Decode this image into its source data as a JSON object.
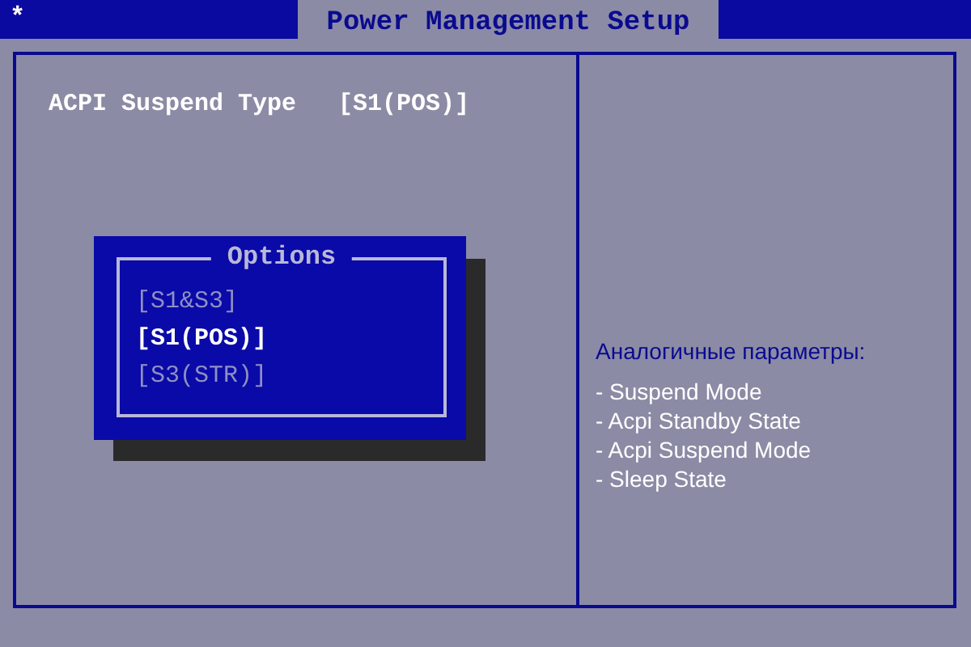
{
  "header": {
    "marker": "*",
    "title": "Power Management Setup"
  },
  "setting": {
    "label": "ACPI Suspend Type",
    "value": "[S1(POS)]"
  },
  "popup": {
    "title": "Options",
    "options": [
      {
        "label": "[S1&S3]",
        "selected": false
      },
      {
        "label": "[S1(POS)]",
        "selected": true
      },
      {
        "label": "[S3(STR)]",
        "selected": false
      }
    ]
  },
  "help": {
    "heading": "Аналогичные параметры:",
    "items": [
      "- Suspend Mode",
      "- Acpi Standby State",
      "- Acpi Suspend Mode",
      "- Sleep State"
    ]
  }
}
